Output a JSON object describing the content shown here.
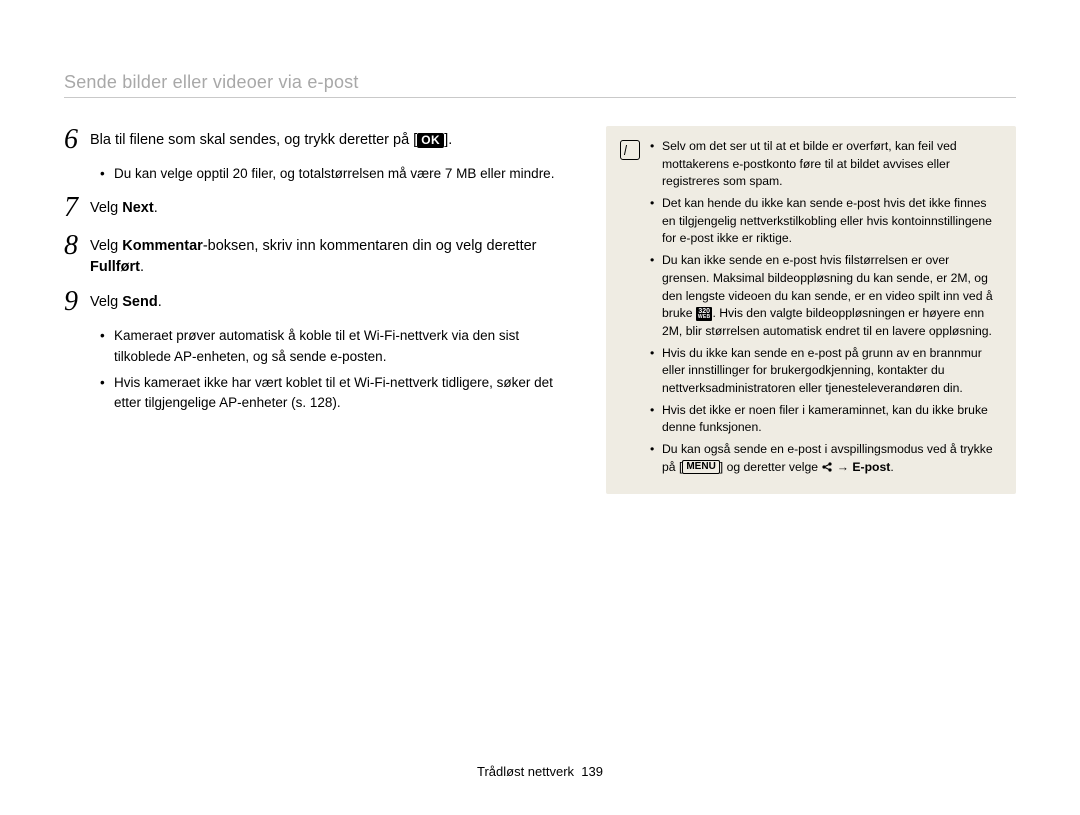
{
  "header": {
    "title": "Sende bilder eller videoer via e-post"
  },
  "left": {
    "steps": [
      {
        "num": "6",
        "text_pre": "Bla til filene som skal sendes, og trykk deretter på [",
        "ok": "OK",
        "text_post": "].",
        "bullets": [
          "Du kan velge opptil 20 filer, og totalstørrelsen må være 7 MB eller mindre."
        ]
      },
      {
        "num": "7",
        "text_pre": "Velg ",
        "bold": "Next",
        "text_post": "."
      },
      {
        "num": "8",
        "text_pre": "Velg ",
        "bold": "Kommentar",
        "text_mid": "-boksen, skriv inn kommentaren din og velg deretter ",
        "bold2": "Fullført",
        "text_post": "."
      },
      {
        "num": "9",
        "text_pre": "Velg ",
        "bold": "Send",
        "text_post": ".",
        "bullets": [
          "Kameraet prøver automatisk å koble til et Wi-Fi-nettverk via den sist tilkoblede AP-enheten, og så sende e-posten.",
          "Hvis kameraet ikke har vært koblet til et Wi-Fi-nettverk tidligere, søker det etter tilgjengelige AP-enheter (s. 128)."
        ]
      }
    ]
  },
  "note": {
    "items": [
      {
        "text": "Selv om det ser ut til at et bilde er overført, kan feil ved mottakerens e-postkonto føre til at bildet avvises eller registreres som spam."
      },
      {
        "text": "Det kan hende du ikke kan sende e-post hvis det ikke finnes en tilgjengelig nettverkstilkobling eller hvis kontoinnstillingene for e-post ikke er riktige."
      },
      {
        "pre": "Du kan ikke sende en e-post hvis filstørrelsen er over grensen. Maksimal bildeoppløsning du kan sende, er 2M, og den lengste videoen du kan sende, er en video spilt inn ved å bruke ",
        "badge_top": "320",
        "badge_bot": "WEB",
        "post": ". Hvis den valgte bildeoppløsningen er høyere enn 2M, blir størrelsen automatisk endret til en lavere oppløsning."
      },
      {
        "text": "Hvis du ikke kan sende en e-post på grunn av en brannmur eller innstillinger for brukergodkjenning, kontakter du nettverksadministratoren eller tjenesteleverandøren din."
      },
      {
        "text": "Hvis det ikke er noen filer i kameraminnet, kan du ikke bruke denne funksjonen."
      },
      {
        "pre": "Du kan også sende en e-post i avspillingsmodus ved å trykke på [",
        "menu": "MENU",
        "mid": "] og deretter velge ",
        "arrow": " → ",
        "bold": "E-post",
        "post": "."
      }
    ]
  },
  "footer": {
    "section": "Trådløst nettverk",
    "page": "139"
  }
}
